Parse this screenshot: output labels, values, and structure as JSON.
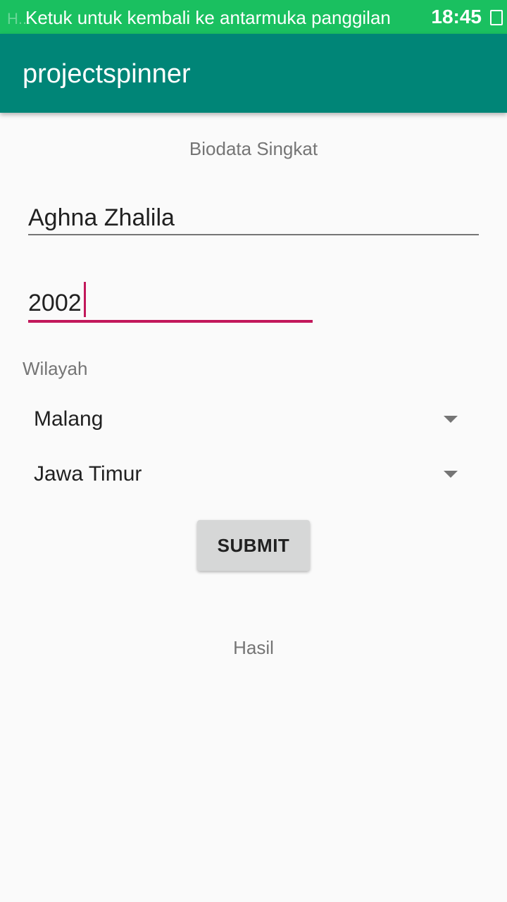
{
  "status_bar": {
    "background_text": "H...",
    "notification": "Ketuk untuk kembali ke antarmuka panggilan",
    "time": "18:45"
  },
  "app_bar": {
    "title": "projectspinner",
    "color": "#008577"
  },
  "form": {
    "heading": "Biodata Singkat",
    "name_value": "Aghna Zhalila",
    "year_value": "2002",
    "region_label": "Wilayah",
    "city_selected": "Malang",
    "province_selected": "Jawa Timur",
    "submit_label": "SUBMIT",
    "result_label": "Hasil"
  },
  "colors": {
    "accent": "#c2185b",
    "status_bar": "#1ac060"
  }
}
